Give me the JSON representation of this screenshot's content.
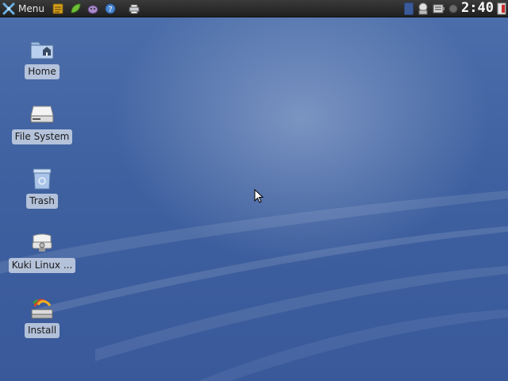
{
  "panel": {
    "menu_label": "Menu",
    "launchers": [
      {
        "name": "file-manager-launcher",
        "icon": "notepad-icon"
      },
      {
        "name": "browser-launcher",
        "icon": "leaf-icon"
      },
      {
        "name": "chat-launcher",
        "icon": "pidgin-icon"
      },
      {
        "name": "help-launcher",
        "icon": "help-icon"
      },
      {
        "name": "print-launcher",
        "icon": "printer-icon"
      }
    ],
    "tray": {
      "clock_text": "2:40",
      "icons": [
        "workspace-switcher-icon",
        "network-icon",
        "battery-icon",
        "volume-icon",
        "logout-icon"
      ]
    }
  },
  "desktop": {
    "icons": [
      {
        "label": "Home",
        "icon": "home-folder-icon"
      },
      {
        "label": "File System",
        "icon": "drive-icon"
      },
      {
        "label": "Trash",
        "icon": "trash-icon"
      },
      {
        "label": "Kuki Linux ...",
        "icon": "optical-drive-icon"
      },
      {
        "label": "Install",
        "icon": "installer-icon"
      }
    ]
  },
  "colors": {
    "wallpaper": "#3f62a0",
    "panel": "#262626",
    "label_bg": "#c8d2e4"
  }
}
